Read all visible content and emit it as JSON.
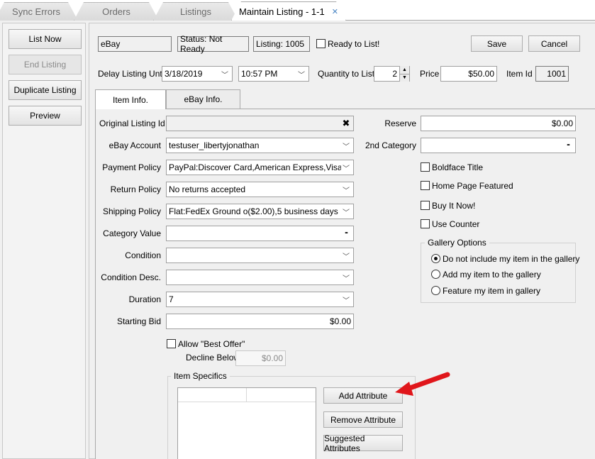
{
  "tabs": [
    {
      "label": "Sync Errors"
    },
    {
      "label": "Orders"
    },
    {
      "label": "Listings"
    },
    {
      "label": "Maintain Listing - 1-1"
    }
  ],
  "tab_close_glyph": "✕",
  "left_actions": {
    "list_now": "List Now",
    "end_listing": "End Listing",
    "duplicate_listing": "Duplicate Listing",
    "preview": "Preview"
  },
  "header": {
    "marketplace": "eBay",
    "status": "Status: Not Ready",
    "listing": "Listing: 1005",
    "ready_label": "Ready to List!",
    "ready_checked": false,
    "save": "Save",
    "cancel": "Cancel"
  },
  "schedule": {
    "delay_label": "Delay Listing Until",
    "date": "3/18/2019",
    "time": "10:57 PM",
    "quantity_label": "Quantity to List",
    "quantity": "2",
    "price_label": "Price",
    "price": "$50.00",
    "item_id_label": "Item Id",
    "item_id": "1001"
  },
  "subtabs": {
    "item_info": "Item Info.",
    "ebay_info": "eBay Info."
  },
  "form": {
    "original_listing_id": {
      "label": "Original Listing Id",
      "value": ""
    },
    "ebay_account": {
      "label": "eBay Account",
      "value": "testuser_libertyjonathan"
    },
    "payment_policy": {
      "label": "Payment Policy",
      "value": "PayPal:Discover Card,American Express,Visa or"
    },
    "return_policy": {
      "label": "Return Policy",
      "value": "No returns accepted"
    },
    "shipping_policy": {
      "label": "Shipping Policy",
      "value": "Flat:FedEx Ground o($2.00),5 business days"
    },
    "category_value": {
      "label": "Category Value",
      "value": ""
    },
    "condition": {
      "label": "Condition",
      "value": ""
    },
    "condition_desc": {
      "label": "Condition Desc.",
      "value": ""
    },
    "duration": {
      "label": "Duration",
      "value": "7"
    },
    "starting_bid": {
      "label": "Starting Bid",
      "value": "$0.00"
    },
    "allow_best_offer": {
      "label": "Allow \"Best Offer\"",
      "checked": false
    },
    "decline_below": {
      "label": "Decline Below",
      "value": "$0.00"
    }
  },
  "right_form": {
    "reserve": {
      "label": "Reserve",
      "value": "$0.00"
    },
    "second_category": {
      "label": "2nd Category",
      "value": ""
    },
    "boldface_title": {
      "label": "Boldface Title",
      "checked": false
    },
    "home_page_featured": {
      "label": "Home Page Featured",
      "checked": false
    },
    "buy_it_now": {
      "label": "Buy It Now!",
      "checked": false
    },
    "use_counter": {
      "label": "Use Counter",
      "checked": false
    }
  },
  "gallery": {
    "title": "Gallery Options",
    "options": [
      {
        "label": "Do not include my item in the gallery",
        "selected": true
      },
      {
        "label": "Add my item to the gallery",
        "selected": false
      },
      {
        "label": "Feature my item in gallery",
        "selected": false
      }
    ]
  },
  "item_specifics": {
    "title": "Item Specifics",
    "add_attribute": "Add Attribute",
    "remove_attribute": "Remove Attribute",
    "suggested_attributes": "Suggested Attributes"
  },
  "glyphs": {
    "chevron": "﹀",
    "ellipsis": "•••",
    "clear": "✖",
    "spin_up": "▲",
    "spin_down": "▼"
  },
  "colors": {
    "arrow": "#e0161b",
    "window_bg": "#f0f0f0",
    "active_tab_bg": "#ffffff"
  }
}
